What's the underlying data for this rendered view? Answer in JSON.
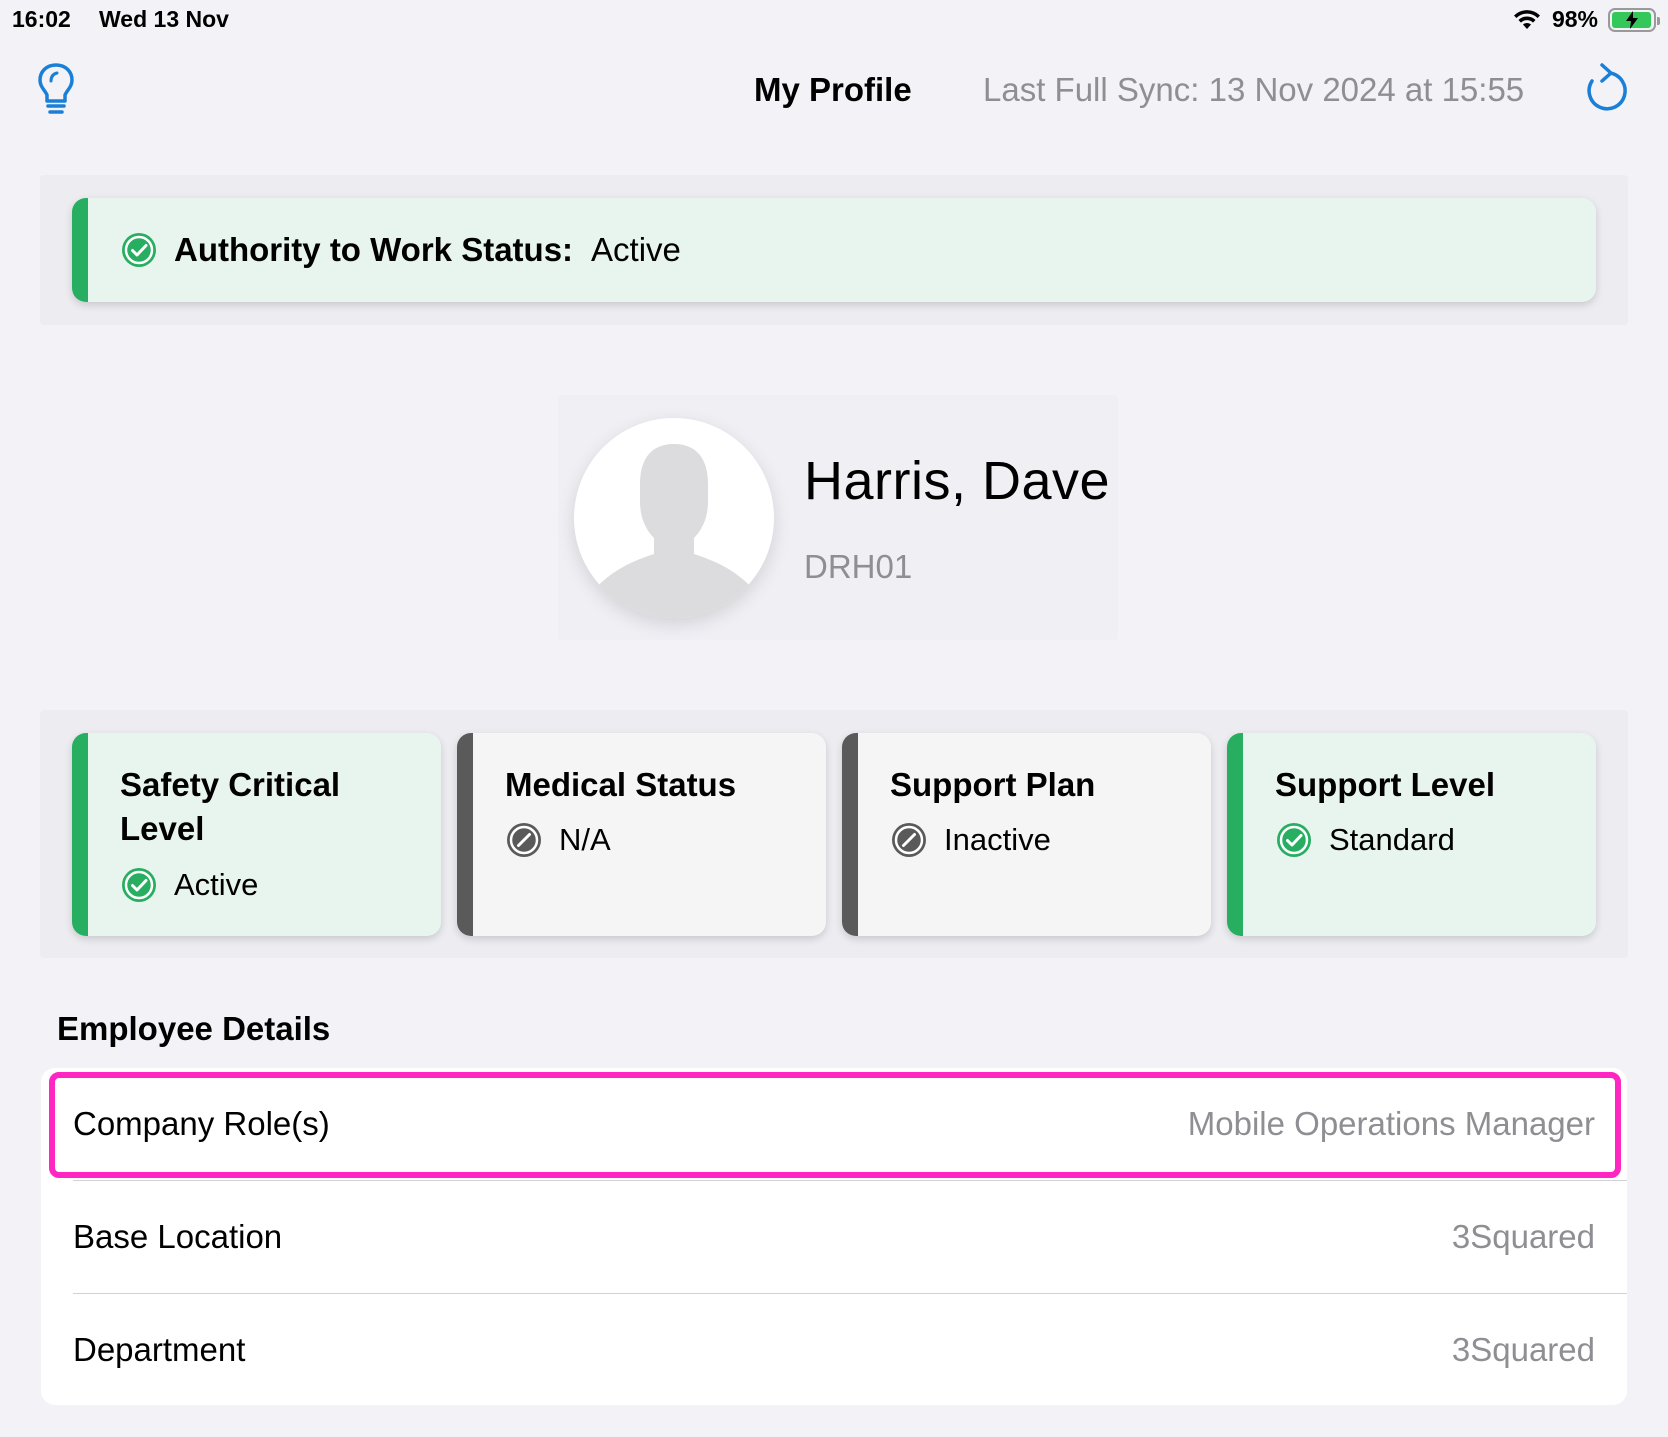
{
  "status_bar": {
    "time": "16:02",
    "date": "Wed 13 Nov",
    "battery": "98%",
    "battery_level": 0.98
  },
  "nav": {
    "title": "My Profile",
    "last_sync": "Last Full Sync: 13 Nov 2024 at 15:55",
    "left_icon": "lightbulb-icon",
    "right_icon": "refresh-icon"
  },
  "authority": {
    "label": "Authority to Work Status:",
    "value": "Active",
    "color": "#27ae60"
  },
  "profile": {
    "name": "Harris, Dave",
    "id": "DRH01"
  },
  "cards": [
    {
      "title": "Safety Critical Level",
      "status": "Active",
      "state": "active",
      "icon": "check-circle-icon"
    },
    {
      "title": "Medical Status",
      "status": "N/A",
      "state": "inactive",
      "icon": "slash-circle-icon"
    },
    {
      "title": "Support Plan",
      "status": "Inactive",
      "state": "inactive",
      "icon": "slash-circle-icon"
    },
    {
      "title": "Support Level",
      "status": "Standard",
      "state": "active",
      "icon": "check-circle-icon"
    }
  ],
  "employee_details": {
    "heading": "Employee Details",
    "rows": [
      {
        "label": "Company Role(s)",
        "value": "Mobile Operations Manager"
      },
      {
        "label": "Base Location",
        "value": "3Squared"
      },
      {
        "label": "Department",
        "value": "3Squared"
      }
    ]
  },
  "colors": {
    "accent": "#1a7fd6",
    "active_green": "#27ae60",
    "inactive_gray": "#5a5a5a",
    "highlight": "#ff26c4"
  }
}
